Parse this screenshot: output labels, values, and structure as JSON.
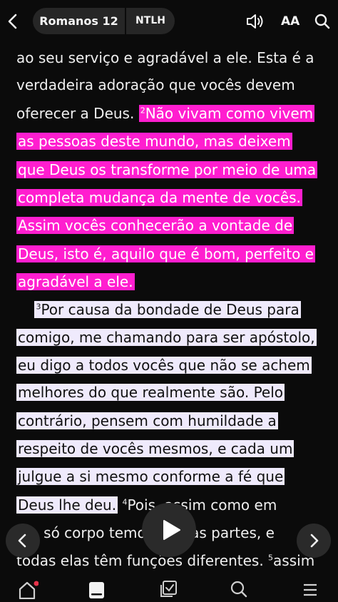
{
  "header": {
    "book_chapter": "Romanos 12",
    "version": "NTLH",
    "font_size_label": "AA"
  },
  "icons": {
    "back": "chevron-left-icon",
    "audio": "speaker-icon",
    "search": "search-icon",
    "prev": "chevron-left-icon",
    "next": "chevron-right-icon",
    "play": "play-icon",
    "home": "home-icon",
    "bible": "bible-icon",
    "plans": "checklist-icon",
    "discover": "search-icon",
    "more": "menu-icon"
  },
  "colors": {
    "highlight_pink": "#ff1ecf",
    "highlight_lavender": "#efeafc",
    "notification_dot": "#e8334a"
  },
  "passage": {
    "lines": [
      {
        "segments": [
          {
            "text": "ao seu serviço e agradável a ele. Esta é a",
            "style": "plain"
          }
        ]
      },
      {
        "segments": [
          {
            "text": "verdadeira adoração que vocês devem",
            "style": "plain"
          }
        ]
      },
      {
        "segments": [
          {
            "text": "oferecer a Deus. ",
            "style": "plain"
          },
          {
            "verse": "2",
            "text": "Não vivam como vivem",
            "style": "pink"
          }
        ]
      },
      {
        "segments": [
          {
            "text": "as pessoas deste mundo, mas deixem",
            "style": "pink"
          }
        ]
      },
      {
        "segments": [
          {
            "text": "que Deus os transforme por meio de uma",
            "style": "pink"
          }
        ]
      },
      {
        "segments": [
          {
            "text": "completa mudança da mente de vocês.",
            "style": "pink"
          }
        ]
      },
      {
        "segments": [
          {
            "text": "Assim vocês conhecerão a vontade de",
            "style": "pink"
          }
        ]
      },
      {
        "segments": [
          {
            "text": "Deus, isto é, aquilo que é bom, perfeito e",
            "style": "pink"
          }
        ]
      },
      {
        "segments": [
          {
            "text": "agradável a ele.",
            "style": "pink"
          }
        ]
      },
      {
        "segments": [
          {
            "text": "    ",
            "style": "plain"
          },
          {
            "verse": "3",
            "text": "Por causa da bondade de Deus para",
            "style": "lavender"
          }
        ]
      },
      {
        "segments": [
          {
            "text": "comigo, me chamando para ser apóstolo,",
            "style": "lavender"
          }
        ]
      },
      {
        "segments": [
          {
            "text": "eu digo a todos vocês que não se achem",
            "style": "lavender"
          }
        ]
      },
      {
        "segments": [
          {
            "text": "melhores do que realmente são. Pelo",
            "style": "lavender"
          }
        ]
      },
      {
        "segments": [
          {
            "text": "contrário, pensem com humildade a",
            "style": "lavender"
          }
        ]
      },
      {
        "segments": [
          {
            "text": "respeito de vocês mesmos, e cada um",
            "style": "lavender"
          }
        ]
      },
      {
        "segments": [
          {
            "text": "julgue a si mesmo conforme a fé que",
            "style": "lavender"
          }
        ]
      },
      {
        "segments": [
          {
            "text": "Deus lhe deu.",
            "style": "lavender"
          },
          {
            "text": " ",
            "style": "plain"
          },
          {
            "verse": "4",
            "text": "Pois, assim como em",
            "style": "plain"
          }
        ]
      },
      {
        "segments": [
          {
            "text": "      só corpo temos muitas partes, e",
            "style": "plain"
          }
        ]
      },
      {
        "segments": [
          {
            "text": "todas elas têm funções diferentes. ",
            "style": "plain"
          },
          {
            "verse": "5",
            "text": "assim",
            "style": "plain"
          }
        ]
      }
    ]
  }
}
